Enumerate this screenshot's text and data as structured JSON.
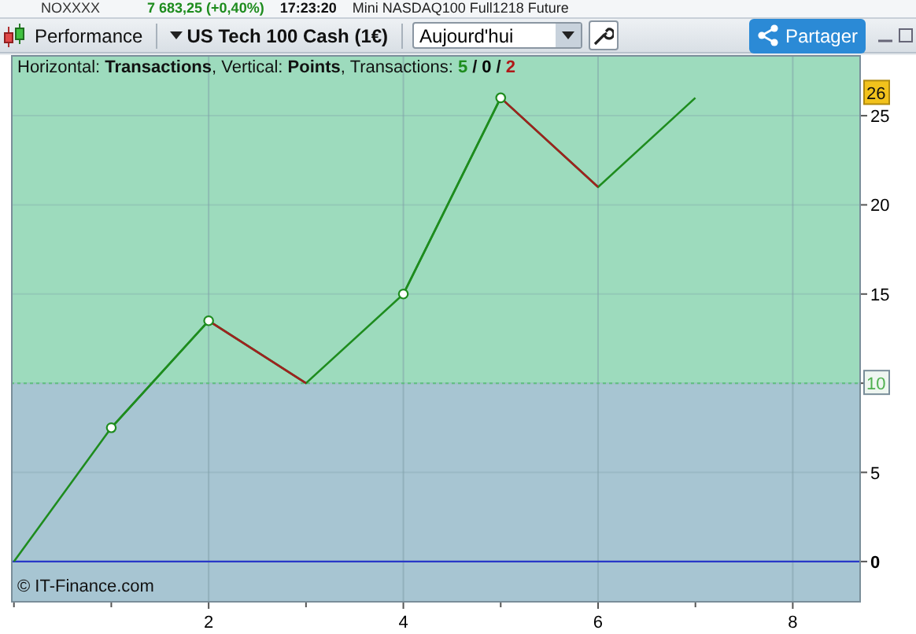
{
  "ticker_strip": [
    {
      "kind": "symbol",
      "text": "NOXXXX"
    },
    {
      "kind": "price",
      "text": "7 683,25 (+0,40%)"
    },
    {
      "kind": "time",
      "text": "17:23:20"
    },
    {
      "kind": "name",
      "text": "Mini NASDAQ100 Full1218 Future"
    }
  ],
  "toolbar": {
    "view": "Performance",
    "instrument": "US Tech 100 Cash (1€)",
    "period": {
      "value": "Aujourd'hui"
    },
    "share_button": "Partager"
  },
  "legend": {
    "text": "Horizontal: **Transactions**, Vertical: **Points**, Transactions:",
    "counts": [
      {
        "kind": "count",
        "text": "5",
        "color": "#1e8c1e"
      },
      {
        "kind": "sep",
        "text": "/"
      },
      {
        "kind": "count",
        "text": "0",
        "color": "#000000"
      },
      {
        "kind": "sep",
        "text": "/"
      },
      {
        "kind": "count",
        "text": "2",
        "color": "#b01818"
      }
    ]
  },
  "copyright": "© IT-Finance.com",
  "chart_data": {
    "type": "line",
    "x": [
      0,
      1,
      2,
      3,
      4,
      5,
      6,
      7
    ],
    "series": [
      {
        "color": "#1e8c1e",
        "values": [
          0,
          7.5,
          13.5,
          10,
          15,
          26,
          21,
          26
        ]
      },
      {
        "color": "#1e8c1e",
        "marker": "circle",
        "values": [
          null,
          7.5,
          13.5,
          null,
          15,
          26,
          null,
          null
        ]
      }
    ],
    "grid": true,
    "bands": [
      {
        "axis": "y",
        "from": 10,
        "to": 28.4,
        "color": "#9ddbbd"
      },
      {
        "axis": "y",
        "from": -2.3,
        "to": 10,
        "color": "#a7c5d2"
      }
    ],
    "xlim": [
      -0.03,
      8.7
    ],
    "ylim": [
      -2.3,
      28.4
    ],
    "xticks": [
      {
        "value": 2,
        "label": "2"
      },
      {
        "value": 4,
        "label": "4"
      },
      {
        "value": 6,
        "label": "6"
      },
      {
        "value": 8,
        "label": "8"
      }
    ],
    "yticks": [
      {
        "value": 0,
        "label": "0"
      },
      {
        "value": 5,
        "label": "5"
      },
      {
        "value": 10,
        "label": "10"
      },
      {
        "value": 15,
        "label": "15"
      },
      {
        "value": 20,
        "label": "20"
      },
      {
        "value": 25,
        "label": "25"
      }
    ],
    "ref_lines": [
      {
        "axis": "y",
        "value": 10,
        "color": "#5fbf7f"
      },
      {
        "axis": "y",
        "value": 0,
        "color": "#2838c8"
      }
    ],
    "annotations": [
      "26"
    ]
  }
}
